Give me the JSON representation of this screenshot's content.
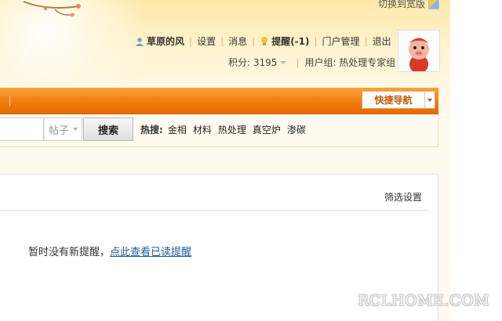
{
  "topbar": {
    "widescreen_label": "切换到宽版"
  },
  "user": {
    "name": "草原的风",
    "settings": "设置",
    "messages": "消息",
    "reminders": "提醒(-1)",
    "portal_admin": "门户管理",
    "logout": "退出",
    "points_label": "积分: 3195",
    "usergroup_label": "用户组: 热处理专家组"
  },
  "nav": {
    "quick_nav_label": "快捷导航"
  },
  "search": {
    "type_label": "帖子",
    "button_label": "搜索",
    "hot_label": "热搜:",
    "hot_terms": [
      "金相",
      "材料",
      "热处理",
      "真空炉",
      "渗碳"
    ]
  },
  "notifications": {
    "filter_settings": "筛选设置",
    "empty_text": "暂时没有新提醒，",
    "view_read_link": "点此查看已读提醒"
  },
  "watermark": "RCLHOME.COM",
  "colors": {
    "nav_orange": "#f17c0e",
    "remind_red": "#e2531b",
    "link_blue": "#1c5d9c"
  }
}
